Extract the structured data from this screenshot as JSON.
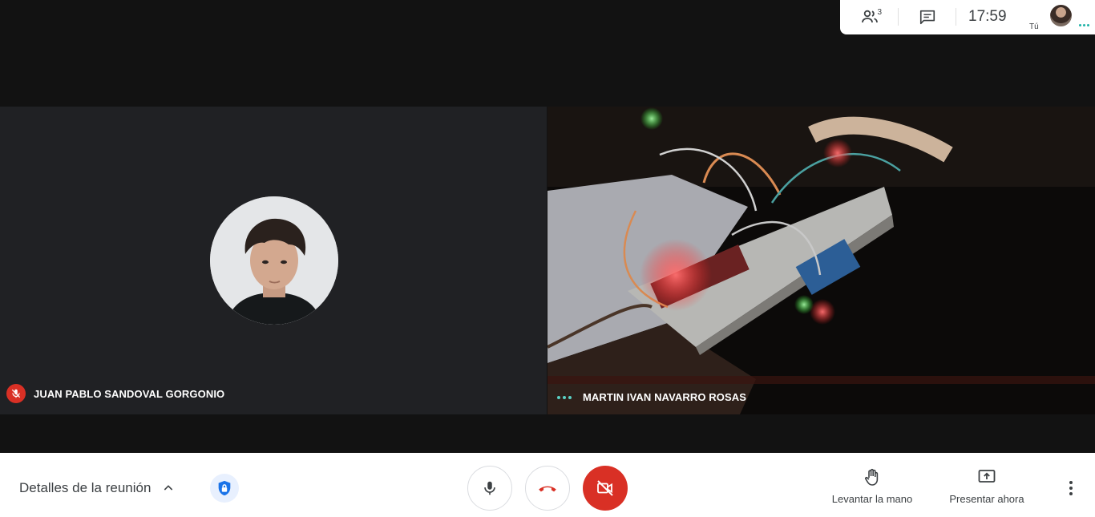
{
  "topbar": {
    "participants_count": "3",
    "time": "17:59",
    "you_label": "Tú"
  },
  "tiles": [
    {
      "name": "JUAN PABLO SANDOVAL GORGONIO",
      "muted": true
    },
    {
      "name": "MARTIN IVAN NAVARRO ROSAS",
      "speaking": true
    }
  ],
  "bottombar": {
    "details_label": "Detalles de la reunión",
    "raise_hand_label": "Levantar la mano",
    "present_label": "Presentar ahora"
  },
  "colors": {
    "danger": "#d93025",
    "tile_bg": "#202124",
    "text": "#3c4043",
    "speaking": "#5ad1c5",
    "shield": "#1a73e8"
  },
  "icons": [
    "people-icon",
    "chat-icon",
    "mic-off-icon",
    "chevron-up-icon",
    "shield-lock-icon",
    "mic-icon",
    "hang-up-icon",
    "camera-off-icon",
    "raise-hand-icon",
    "present-screen-icon",
    "more-vert-icon"
  ]
}
